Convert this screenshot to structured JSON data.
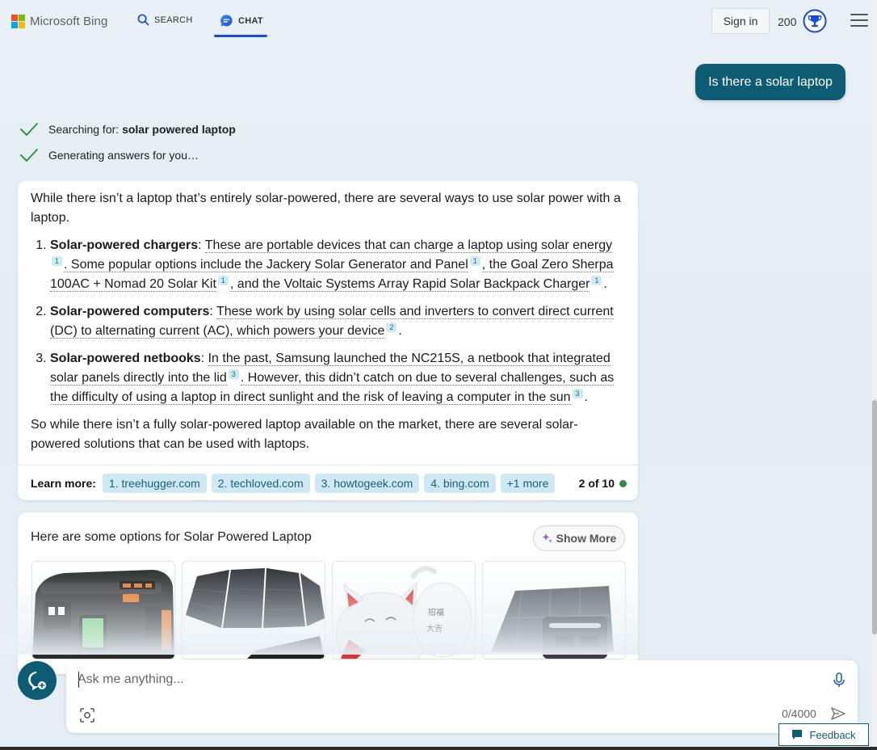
{
  "header": {
    "logo_text": "Microsoft Bing",
    "search_tab": "SEARCH",
    "chat_tab": "CHAT",
    "sign_in": "Sign in",
    "points": "200",
    "accent_color": "#174ae4"
  },
  "conversation": {
    "user_message": "Is there a solar laptop",
    "status": [
      {
        "prefix": "Searching for: ",
        "bold": "solar powered laptop"
      },
      {
        "prefix": "Generating answers for you…",
        "bold": ""
      }
    ]
  },
  "answer": {
    "intro": "While there isn’t a laptop that’s entirely solar-powered, there are several ways to use solar power with a laptop.",
    "items": [
      {
        "title": "Solar-powered chargers",
        "text_1": "These are portable devices that can charge a laptop using solar energy",
        "cite_1": "1",
        "text_2": ". Some popular options include the Jackery Solar Generator and Panel",
        "cite_2": "1",
        "text_3": ", the Goal Zero Sherpa 100AC + Nomad 20 Solar Kit",
        "cite_3": "1",
        "text_4": ", and the Voltaic Systems Array Rapid Solar Backpack Charger",
        "cite_4": "1",
        "text_5": "."
      },
      {
        "title": "Solar-powered computers",
        "text_1": "These work by using solar cells and inverters to convert direct current (DC) to alternating current (AC), which powers your device",
        "cite_1": "2",
        "text_2": "."
      },
      {
        "title": "Solar-powered netbooks",
        "text_1": "In the past, Samsung launched the NC215S, a netbook that integrated solar panels directly into the lid",
        "cite_1": "3",
        "text_2": ". However, this didn’t catch on due to several challenges, such as the difficulty of using a laptop in direct sunlight and the risk of leaving a computer in the sun",
        "cite_2": "3",
        "text_3": "."
      }
    ],
    "conclusion": "So while there isn’t a fully solar-powered laptop available on the market, there are several solar-powered solutions that can be used with laptops.",
    "learn_more_label": "Learn more:",
    "sources": [
      "1. treehugger.com",
      "2. techloved.com",
      "3. howtogeek.com",
      "4. bing.com",
      "+1 more"
    ],
    "turn_count": "2 of 10",
    "turn_status_color": "#2f8a48"
  },
  "options": {
    "title": "Here are some options for Solar Powered Laptop",
    "show_more": "Show More",
    "products": [
      {
        "image": "portable-power-station-image"
      },
      {
        "image": "foldable-solar-panel-image"
      },
      {
        "image": "lucky-cat-figure-image"
      },
      {
        "image": "solar-generator-with-panel-image"
      }
    ]
  },
  "composer": {
    "placeholder": "Ask me anything...",
    "char_count": "0/4000"
  },
  "feedback_label": "Feedback"
}
